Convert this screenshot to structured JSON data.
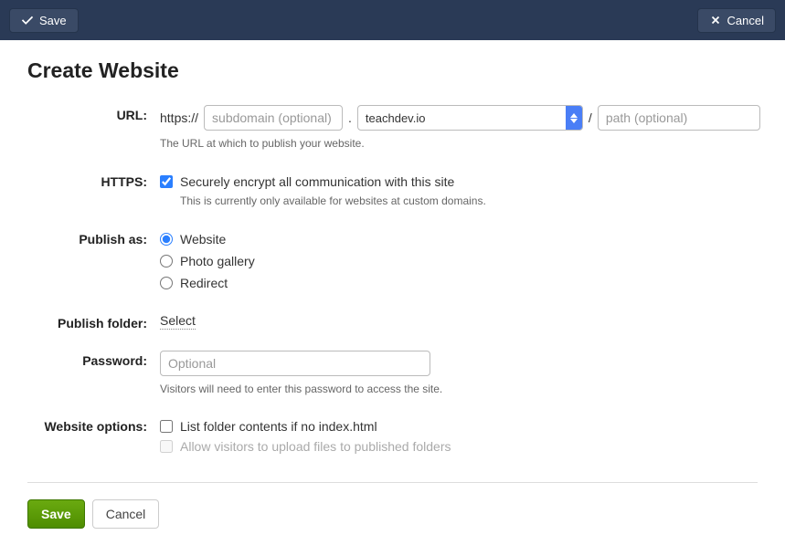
{
  "topbar": {
    "save_label": "Save",
    "cancel_label": "Cancel"
  },
  "page_title": "Create Website",
  "labels": {
    "url": "URL:",
    "https": "HTTPS:",
    "publish_as": "Publish as:",
    "publish_folder": "Publish folder:",
    "password": "Password:",
    "website_options": "Website options:"
  },
  "url": {
    "prefix": "https://",
    "subdomain_placeholder": "subdomain (optional)",
    "subdomain_value": "",
    "dot": ".",
    "domain_selected": "teachdev.io",
    "slash": "/",
    "path_placeholder": "path (optional)",
    "path_value": "",
    "help": "The URL at which to publish your website."
  },
  "https": {
    "checked": true,
    "label": "Securely encrypt all communication with this site",
    "help": "This is currently only available for websites at custom domains."
  },
  "publish_as": {
    "selected": "website",
    "options": {
      "website": "Website",
      "photo_gallery": "Photo gallery",
      "redirect": "Redirect"
    }
  },
  "publish_folder": {
    "select_label": "Select"
  },
  "password": {
    "placeholder": "Optional",
    "value": "",
    "help": "Visitors will need to enter this password to access the site."
  },
  "website_options": {
    "list_folder": {
      "checked": false,
      "label": "List folder contents if no index.html"
    },
    "allow_upload": {
      "checked": false,
      "disabled": true,
      "label": "Allow visitors to upload files to published folders"
    }
  },
  "bottom": {
    "save_label": "Save",
    "cancel_label": "Cancel"
  }
}
